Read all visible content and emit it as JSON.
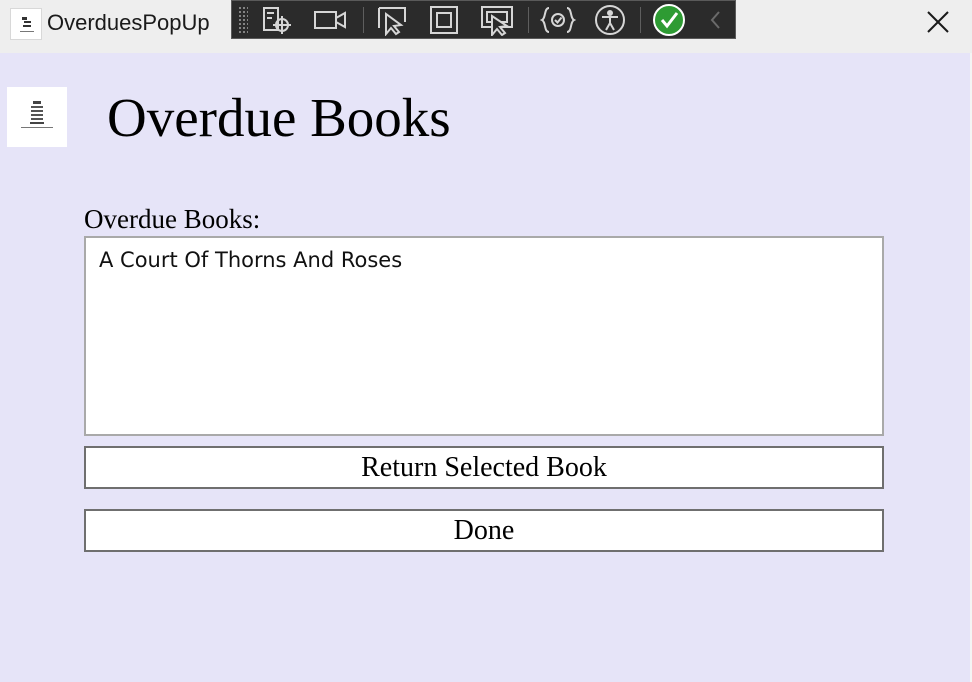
{
  "window": {
    "title": "OverduesPopUp"
  },
  "toolbar": {
    "items": [
      {
        "icon": "select-element-icon"
      },
      {
        "icon": "camera-icon"
      },
      {
        "icon": "cursor-select-icon"
      },
      {
        "icon": "layout-adorner-icon"
      },
      {
        "icon": "track-focus-icon"
      },
      {
        "icon": "binding-failures-icon"
      },
      {
        "icon": "accessibility-icon"
      },
      {
        "icon": "checkmark-status-icon"
      },
      {
        "icon": "collapse-chevron-icon"
      }
    ],
    "status_color": "#2e9b33"
  },
  "main": {
    "title": "Overdue Books",
    "list_label": "Overdue Books:",
    "overdue_books": [
      "A Court Of Thorns And Roses"
    ],
    "return_button": "Return Selected Book",
    "done_button": "Done"
  },
  "colors": {
    "background": "#e6e4f8",
    "titlebar": "#eeeeee",
    "toolbar": "#2b2b2b"
  }
}
